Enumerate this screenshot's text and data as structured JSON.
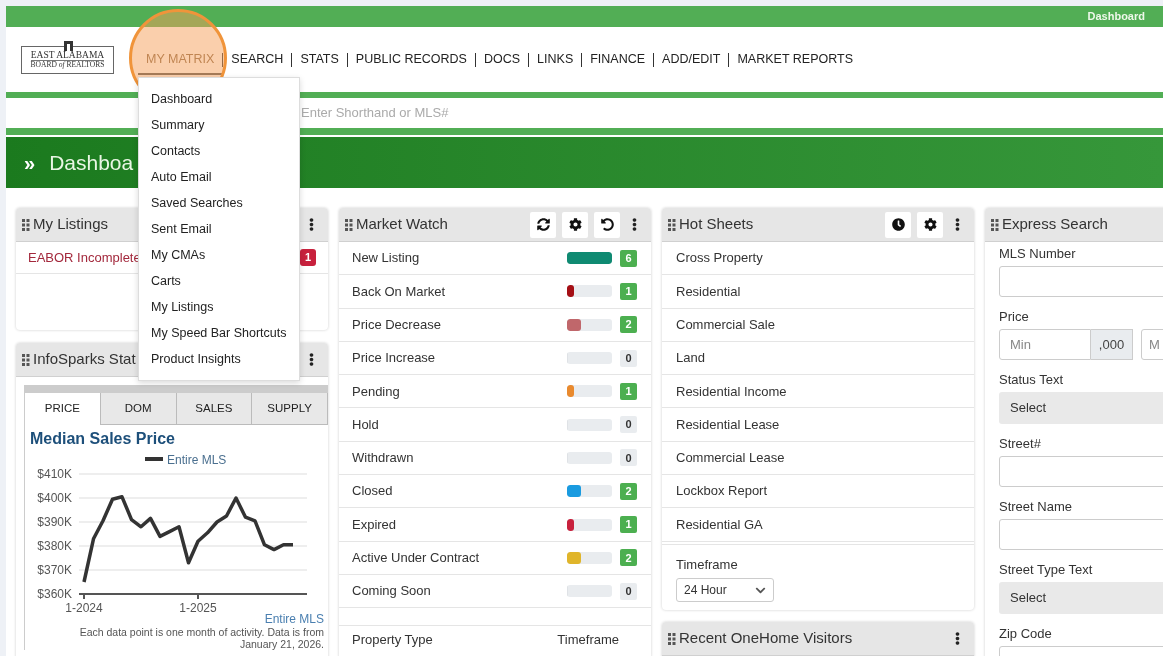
{
  "top_bar": {
    "link": "Dashboard"
  },
  "logo": {
    "line1": "EAST ALABAMA",
    "line2": "BOARD *of* REALTORS"
  },
  "nav": [
    {
      "label": "MY MATRIX",
      "selected": true
    },
    {
      "label": "SEARCH",
      "selected": false
    },
    {
      "label": "STATS",
      "selected": false
    },
    {
      "label": "PUBLIC RECORDS",
      "selected": false
    },
    {
      "label": "DOCS",
      "selected": false
    },
    {
      "label": "LINKS",
      "selected": false
    },
    {
      "label": "FINANCE",
      "selected": false
    },
    {
      "label": "ADD/EDIT",
      "selected": false
    },
    {
      "label": "MARKET REPORTS",
      "selected": false
    }
  ],
  "nav_menu": [
    "Dashboard",
    "Summary",
    "Contacts",
    "Auto Email",
    "Saved Searches",
    "Sent Email",
    "My CMAs",
    "Carts",
    "My Listings",
    "My Speed Bar Shortcuts",
    "Product Insights"
  ],
  "speed_bar": {
    "placeholder": "Enter Shorthand or MLS#"
  },
  "page_header": {
    "icon": "»",
    "title": "Dashboa"
  },
  "my_listings": {
    "title": "My Listings",
    "rows": [
      {
        "label": "EABOR Incomplete",
        "count": "1"
      }
    ]
  },
  "infosparks": {
    "title": "InfoSparks Stat",
    "tabs": [
      {
        "label": "PRICE",
        "selected": true
      },
      {
        "label": "DOM",
        "selected": false
      },
      {
        "label": "SALES",
        "selected": false
      },
      {
        "label": "SUPPLY",
        "selected": false
      }
    ],
    "chart_data": {
      "type": "line",
      "title": "Median Sales Price",
      "categories": [
        "1-2024",
        null,
        null,
        null,
        null,
        null,
        null,
        null,
        null,
        null,
        null,
        null,
        "1-2025",
        null,
        null,
        null,
        null,
        null,
        null,
        null,
        null,
        null,
        null
      ],
      "series": [
        {
          "name": "Entire MLS",
          "color": "#333333",
          "values": [
            365,
            383,
            390.5,
            399.5,
            400.5,
            391,
            388,
            391.5,
            384,
            386,
            388,
            373,
            382,
            385.5,
            390,
            392.5,
            400,
            392,
            390.5,
            380.5,
            378.5,
            380.5,
            380.5
          ]
        }
      ],
      "ylim": [
        360,
        410
      ],
      "grid": true,
      "yticks": [
        {
          "value": 360,
          "label": "$360K"
        },
        {
          "value": 370,
          "label": "$370K"
        },
        {
          "value": 380,
          "label": "$380K"
        },
        {
          "value": 390,
          "label": "$390K"
        },
        {
          "value": 400,
          "label": "$400K"
        },
        {
          "value": 410,
          "label": "$410K"
        }
      ]
    },
    "source_link": "Entire MLS",
    "note": "Each data point is one month of activity. Data is from January 21, 2026."
  },
  "market_watch": {
    "title": "Market Watch",
    "rows": [
      {
        "label": "New Listing",
        "level": 1,
        "color": "#0f8a72",
        "count": "6",
        "active": true
      },
      {
        "label": "Back On Market",
        "level": 0.15,
        "color": "#a50f15",
        "count": "1",
        "active": true
      },
      {
        "label": "Price Decrease",
        "level": 0.32,
        "color": "#c0676b",
        "count": "2",
        "active": true
      },
      {
        "label": "Price Increase",
        "level": 0,
        "count": "0",
        "active": false
      },
      {
        "label": "Pending",
        "level": 0.15,
        "color": "#e98a2e",
        "count": "1",
        "active": true
      },
      {
        "label": "Hold",
        "level": 0,
        "count": "0",
        "active": false
      },
      {
        "label": "Withdrawn",
        "level": 0,
        "count": "0",
        "active": false
      },
      {
        "label": "Closed",
        "level": 0.32,
        "color": "#1a9be0",
        "count": "2",
        "active": true
      },
      {
        "label": "Expired",
        "level": 0.15,
        "color": "#c8213d",
        "count": "1",
        "active": true
      },
      {
        "label": "Active Under Contract",
        "level": 0.32,
        "color": "#e0b52a",
        "count": "2",
        "active": true
      },
      {
        "label": "Coming Soon",
        "level": 0,
        "count": "0",
        "active": false
      }
    ],
    "footer": [
      "Property Type",
      "Timeframe"
    ]
  },
  "hot_sheets": {
    "title": "Hot Sheets",
    "items": [
      "Cross Property",
      "Residential",
      "Commercial Sale",
      "Land",
      "Residential Income",
      "Residential Lease",
      "Commercial Lease",
      "Lockbox Report",
      "Residential GA"
    ],
    "timeframe": {
      "label": "Timeframe",
      "value": "24 Hour"
    }
  },
  "recent_visitors": {
    "title": "Recent OneHome Visitors"
  },
  "express_search": {
    "title": "Express Search",
    "fields": [
      {
        "kind": "input",
        "label": "MLS Number"
      },
      {
        "kind": "price",
        "label": "Price",
        "placeholder": "Min",
        "addon": ",000",
        "second_placeholder": "M"
      },
      {
        "kind": "select",
        "label": "Status Text",
        "value": "Select"
      },
      {
        "kind": "input",
        "label": "Street#"
      },
      {
        "kind": "input",
        "label": "Street Name"
      },
      {
        "kind": "select",
        "label": "Street Type Text",
        "value": "Select"
      },
      {
        "kind": "input",
        "label": "Zip Code"
      }
    ]
  }
}
